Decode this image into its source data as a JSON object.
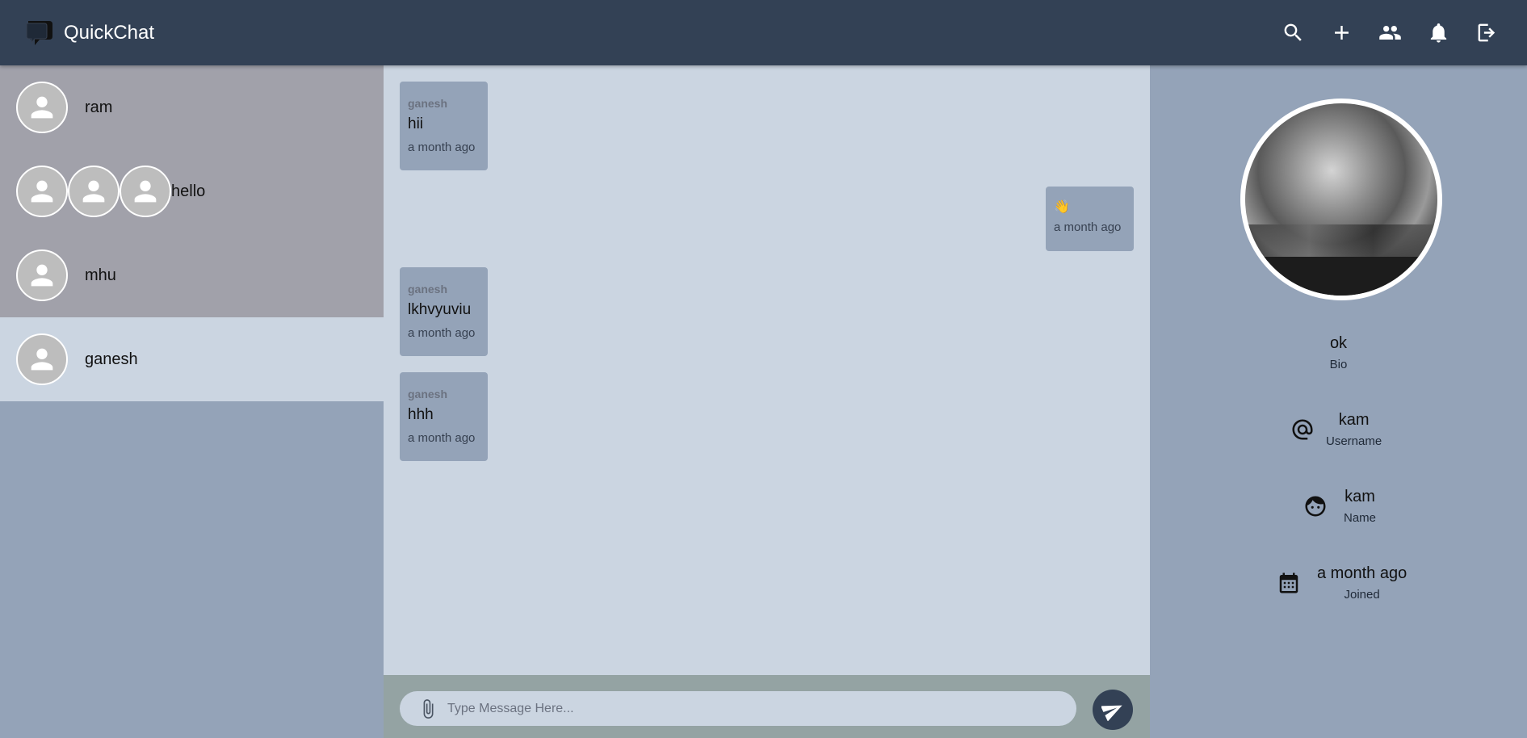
{
  "app": {
    "title": "QuickChat"
  },
  "header": {
    "actions": [
      {
        "name": "search",
        "icon": "search-icon"
      },
      {
        "name": "new-chat",
        "icon": "plus-icon"
      },
      {
        "name": "groups",
        "icon": "people-icon"
      },
      {
        "name": "notifications",
        "icon": "bell-icon"
      },
      {
        "name": "logout",
        "icon": "logout-icon"
      }
    ]
  },
  "sidebar": {
    "conversations": [
      {
        "name": "ram",
        "type": "direct",
        "active": false
      },
      {
        "name": "hello",
        "type": "group",
        "active": false
      },
      {
        "name": "mhu",
        "type": "direct",
        "active": false
      },
      {
        "name": "ganesh",
        "type": "direct",
        "active": true
      }
    ]
  },
  "chat": {
    "messages": [
      {
        "sender": "ganesh",
        "text": "hii",
        "time": "a month ago",
        "own": false
      },
      {
        "sender": "",
        "text": "👋",
        "time": "a month ago",
        "own": true
      },
      {
        "sender": "ganesh",
        "text": "lkhvyuviu",
        "time": "a month ago",
        "own": false
      },
      {
        "sender": "ganesh",
        "text": "hhh",
        "time": "a month ago",
        "own": false
      }
    ]
  },
  "composer": {
    "placeholder": "Type Message Here...",
    "value": ""
  },
  "profile": {
    "bio": {
      "value": "ok",
      "label": "Bio"
    },
    "username": {
      "value": "kam",
      "label": "Username",
      "icon": "at-icon"
    },
    "name": {
      "value": "kam",
      "label": "Name",
      "icon": "face-icon"
    },
    "joined": {
      "value": "a month ago",
      "label": "Joined",
      "icon": "calendar-icon"
    }
  },
  "colors": {
    "header": "#334155",
    "sidebar_item": "#a1a1aa",
    "active_item": "#cbd5e1",
    "chat_bg": "#cbd5e1",
    "bubble": "#94a3b8",
    "panel": "#94a3b8"
  }
}
